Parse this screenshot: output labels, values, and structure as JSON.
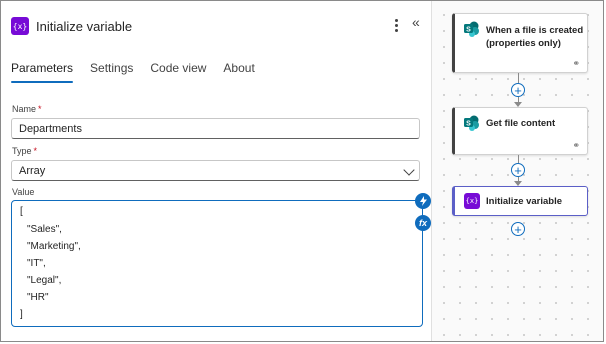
{
  "panel": {
    "icon_text": "{x}",
    "title": "Initialize variable",
    "tabs": [
      {
        "label": "Parameters",
        "active": true
      },
      {
        "label": "Settings",
        "active": false
      },
      {
        "label": "Code view",
        "active": false
      },
      {
        "label": "About",
        "active": false
      }
    ],
    "fields": {
      "name_label": "Name",
      "name_required": "*",
      "name_value": "Departments",
      "type_label": "Type",
      "type_required": "*",
      "type_value": "Array",
      "value_label": "Value",
      "value_lines": [
        "[",
        "\"Sales\",",
        "\"Marketing\",",
        "\"IT\",",
        "\"Legal\",",
        "\"HR\"",
        "]"
      ]
    }
  },
  "flow": {
    "steps": [
      {
        "title_line1": "When a file is created",
        "title_line2": "(properties only)",
        "icon": "sharepoint-icon",
        "has_link": true
      },
      {
        "title_line1": "Get file content",
        "icon": "sharepoint-icon",
        "has_link": true
      },
      {
        "title_line1": "Initialize variable",
        "icon_text": "{x}",
        "selected": true
      }
    ]
  },
  "colors": {
    "accent": "#0f6cbd",
    "variable_icon": "#770bd6",
    "sharepoint": "#03787c",
    "selected_border": "#5b5fc7"
  }
}
